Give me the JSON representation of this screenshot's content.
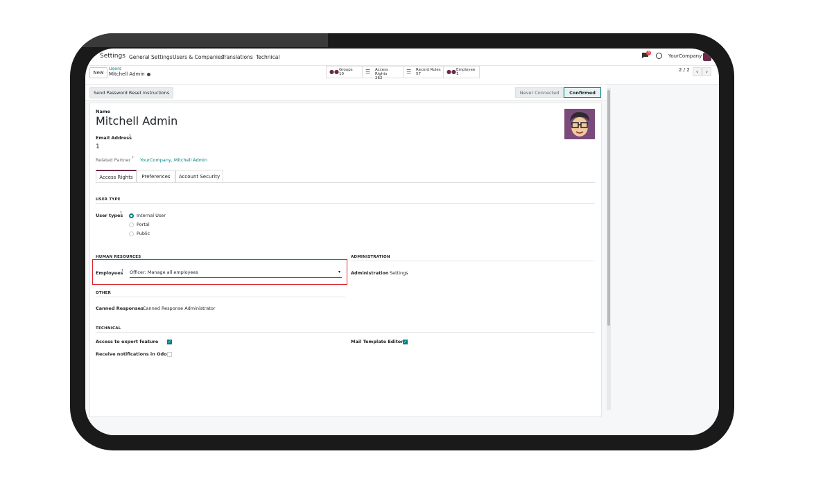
{
  "nav": {
    "app": "Settings",
    "menu": [
      "General Settings",
      "Users & Companies",
      "Translations",
      "Technical"
    ],
    "chat_badge": "3",
    "company": "YourCompany"
  },
  "control": {
    "new_label": "New",
    "breadcrumb_parent": "Users",
    "breadcrumb_current": "Mitchell Admin",
    "stats": [
      {
        "label": "Groups",
        "value": "10"
      },
      {
        "label": "Access Rights",
        "value": "262"
      },
      {
        "label": "Record Rules",
        "value": "57"
      },
      {
        "label": "Employee",
        "value": "1"
      }
    ],
    "pager": "2 / 2"
  },
  "statusbar": {
    "reset_label": "Send Password Reset Instructions",
    "stages": [
      "Never Connected",
      "Confirmed"
    ],
    "active_stage": "Confirmed"
  },
  "form": {
    "name_label": "Name",
    "name": "Mitchell Admin",
    "email_label": "Email Address",
    "email_value": "1",
    "partner_label": "Related Partner",
    "partner_value": "YourCompany, Mitchell Admin",
    "tabs": [
      "Access Rights",
      "Preferences",
      "Account Security"
    ],
    "active_tab": "Access Rights",
    "user_type_section": "USER TYPE",
    "user_types_label": "User types",
    "user_types": [
      "Internal User",
      "Portal",
      "Public"
    ],
    "user_types_selected": "Internal User",
    "hr_section": "HUMAN RESOURCES",
    "employees_label": "Employees",
    "employees_value": "Officer: Manage all employees",
    "admin_section": "ADMINISTRATION",
    "administration_label": "Administration",
    "administration_value": "Settings",
    "other_section": "OTHER",
    "canned_label": "Canned Responses",
    "canned_value": "Canned Response Administrator",
    "technical_section": "TECHNICAL",
    "export_label": "Access to export feature",
    "export_checked": true,
    "notif_label": "Receive notifications in Odoo",
    "notif_checked": false,
    "mail_template_label": "Mail Template Editor",
    "mail_template_checked": true,
    "help_mark": "?"
  },
  "colors": {
    "accent": "#017e84",
    "brand": "#6b2a4a",
    "highlight": "#d9282f"
  }
}
